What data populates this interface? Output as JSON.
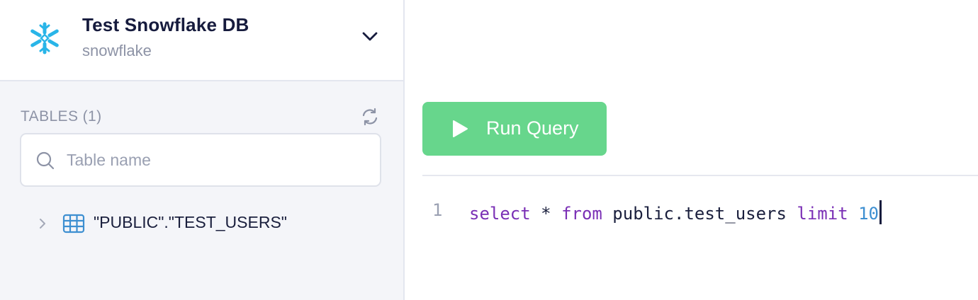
{
  "connection": {
    "name": "Test Snowflake DB",
    "type": "snowflake"
  },
  "tables": {
    "header": "TABLES (1)",
    "search_placeholder": "Table name",
    "search_value": "",
    "items": [
      {
        "label": "\"PUBLIC\".\"TEST_USERS\""
      }
    ]
  },
  "toolbar": {
    "run_label": "Run Query"
  },
  "editor": {
    "line_number": "1",
    "tokens": {
      "select": "select",
      "star": " * ",
      "from": "from",
      "ident": " public.test_users ",
      "limit": "limit",
      "limit_value": "10"
    }
  },
  "colors": {
    "snowflake_brand": "#29b5e8",
    "run_button": "#67d68c",
    "keyword": "#7a2fb5",
    "number": "#3d8fd1",
    "table_icon": "#3d8fd1"
  },
  "icons": [
    "snowflake-logo-icon",
    "chevron-down-icon",
    "refresh-icon",
    "search-icon",
    "chevron-right-icon",
    "table-grid-icon",
    "play-icon"
  ]
}
